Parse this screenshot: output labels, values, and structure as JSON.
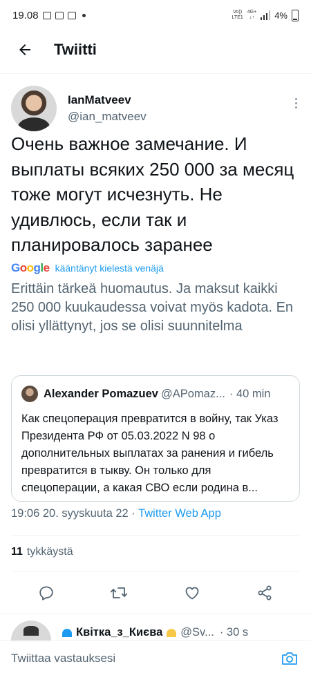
{
  "status_bar": {
    "time": "19.08",
    "network_top": "Vo))",
    "network_bottom": "LTE1",
    "data_top": "4G+",
    "data_bottom": "↓↑",
    "battery": "4%"
  },
  "header": {
    "title": "Twiitti",
    "back_icon": "arrow-left-icon"
  },
  "tweet": {
    "author_name": "IanMatveev",
    "author_handle": "@ian_matveev",
    "text": "Очень важное замечание. И выплаты всяких 250 000 за месяц тоже могут исчезнуть. Не удивлюсь, если так и планировалось заранее",
    "translation_label": "kääntänyt kielestä venäjä",
    "google": [
      "G",
      "o",
      "o",
      "g",
      "l",
      "e"
    ],
    "google_colors": [
      "#4285F4",
      "#EA4335",
      "#FBBC05",
      "#4285F4",
      "#34A853",
      "#EA4335"
    ],
    "translated_text": "Erittäin tärkeä huomautus. Ja maksut kaikki 250 000 kuukaudessa voivat myös kadota. En olisi yllättynyt, jos se olisi suunnitelma",
    "quote": {
      "name": "Alexander Pomazuev",
      "handle": "@APomaz...",
      "time": "· 40 min",
      "text": "Как спецоперация превратится в войну, так Указ Президента РФ от 05.03.2022 N 98 о дополнительных выплатах за ранения и гибель превратится в тыкву. Он только для спецоперации, а какая СВО если родина в..."
    },
    "timestamp": "19:06 20. syyskuuta 22 · ",
    "source": "Twitter Web App",
    "likes_count": "11",
    "likes_label": "tykkäystä"
  },
  "reply_preview": {
    "name": "Квітка_з_Києва",
    "handle": "@Sv...",
    "time": "· 30 s",
    "heart_left_color": "#1d9bf0",
    "heart_right_color": "#f7c948"
  },
  "reply_bar": {
    "placeholder": "Twiittaa vastauksesi"
  },
  "colors": {
    "accent": "#1d9bf0",
    "text": "#0f1419",
    "secondary": "#536471"
  }
}
